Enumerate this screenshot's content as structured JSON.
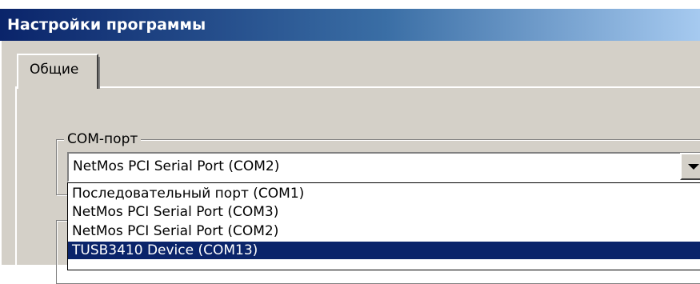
{
  "window": {
    "title": "Настройки программы"
  },
  "tabs": [
    {
      "label": "Общие",
      "active": true
    }
  ],
  "com_port_group": {
    "legend": "COM-порт",
    "combo": {
      "selected_value": "NetMos PCI Serial Port (COM2)",
      "expanded": true,
      "options": [
        "Последовательный порт (COM1)",
        "NetMos PCI Serial Port (COM3)",
        "NetMos PCI Serial Port (COM2)",
        "TUSB3410 Device (COM13)"
      ],
      "highlighted_option_index": 3
    }
  },
  "colors": {
    "title_gradient_start": "#0a246a",
    "title_gradient_end": "#a6caf0",
    "face": "#d4d0c8",
    "highlight": "#0a246a",
    "highlight_text": "#ffffff"
  },
  "icons": {
    "combo_arrow": "chevron-down-icon"
  }
}
